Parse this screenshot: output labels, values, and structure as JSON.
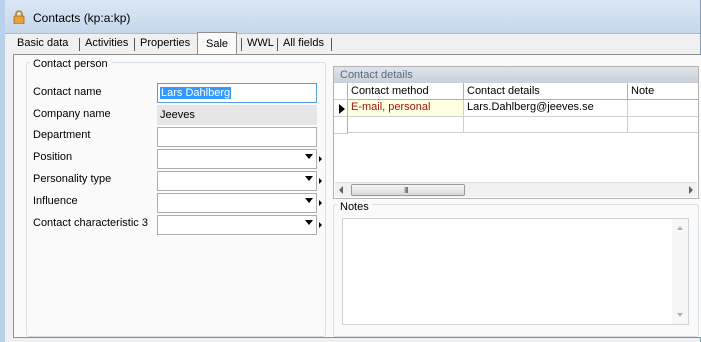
{
  "window": {
    "title": "Contacts (kp:a:kp)",
    "icon": "lock-icon"
  },
  "tabs": [
    {
      "label": "Basic data"
    },
    {
      "label": "Activities"
    },
    {
      "label": "Properties"
    },
    {
      "label": "Sale",
      "active": true
    },
    {
      "label": "WWL"
    },
    {
      "label": "All fields"
    }
  ],
  "contact_person": {
    "legend": "Contact person",
    "fields": [
      {
        "label": "Contact name",
        "value": "Lars Dahlberg",
        "type": "text"
      },
      {
        "label": "Company name",
        "value": "Jeeves",
        "type": "readonly"
      },
      {
        "label": "Department",
        "value": "",
        "type": "text"
      },
      {
        "label": "Position",
        "value": "",
        "type": "combo"
      },
      {
        "label": "Personality type",
        "value": "",
        "type": "combo"
      },
      {
        "label": "Influence",
        "value": "",
        "type": "combo"
      },
      {
        "label": "Contact characteristic 3",
        "value": "",
        "type": "combo"
      }
    ]
  },
  "contact_details": {
    "title": "Contact details",
    "columns": [
      "Contact method",
      "Contact details",
      "Note"
    ],
    "rows": [
      {
        "method": "E-mail, personal",
        "details": "Lars.Dahlberg@jeeves.se",
        "note": ""
      }
    ],
    "scroll_grip": "III"
  },
  "notes": {
    "legend": "Notes",
    "value": ""
  },
  "colors": {
    "selected_row_text": "#a31515",
    "selected_row_bg": "#ffffe1",
    "selection": "#3399ff"
  }
}
